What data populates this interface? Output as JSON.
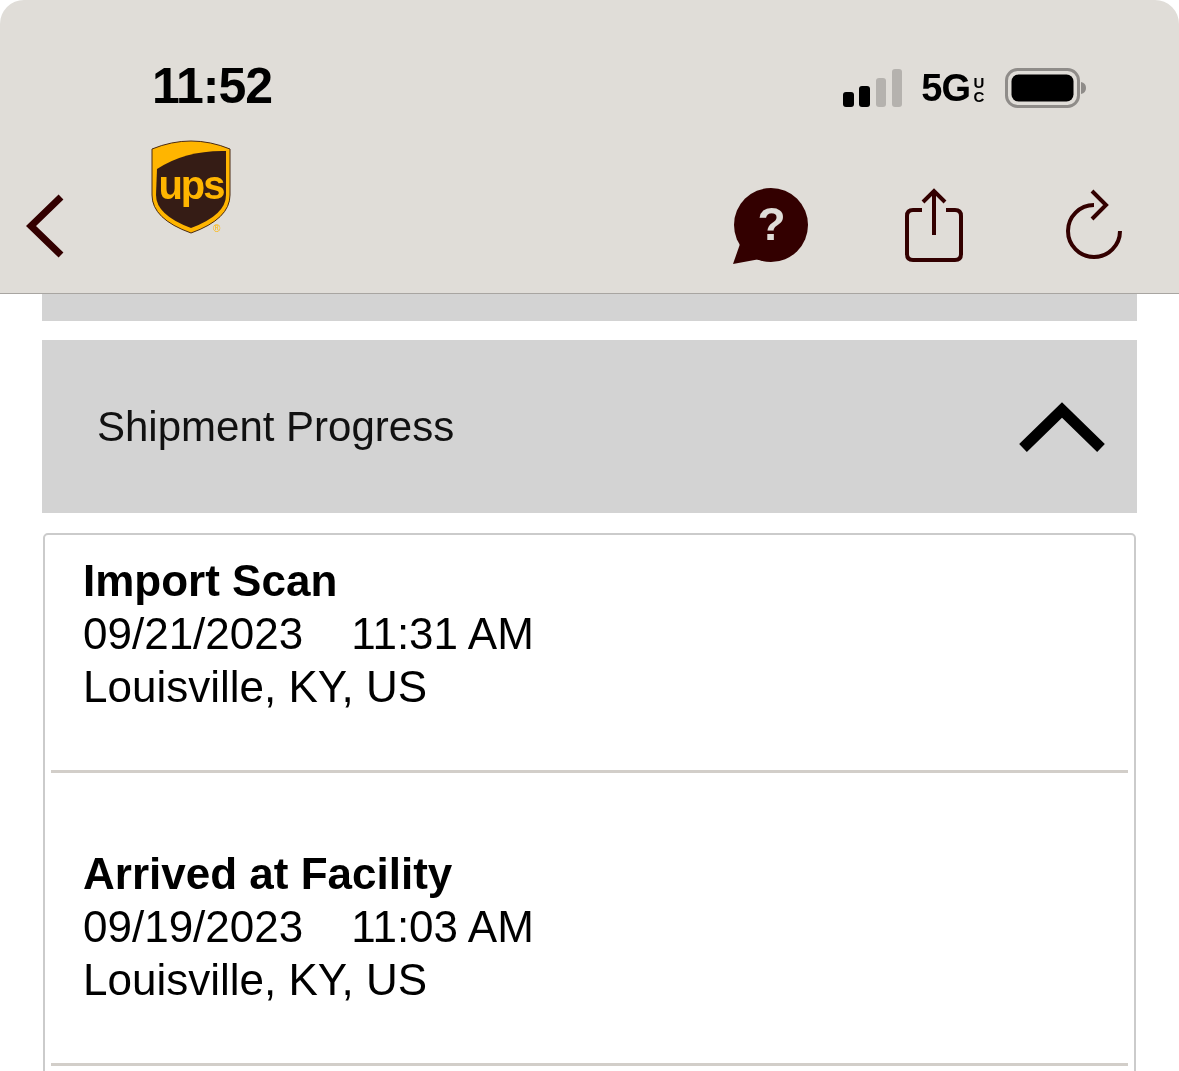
{
  "status_bar": {
    "time": "11:52",
    "network": "5G",
    "network_suffix": "UC"
  },
  "nav_bar": {
    "logo": {
      "text": "ups",
      "mark": "®"
    },
    "help_button": {
      "label": "?"
    }
  },
  "panel": {
    "title": "Shipment Progress",
    "expanded": true,
    "events": [
      {
        "title": "Import Scan",
        "date": "09/21/2023",
        "time": "11:31 AM",
        "location": "Louisville, KY, US"
      },
      {
        "title": "Arrived at Facility",
        "date": "09/19/2023",
        "time": "11:03 AM",
        "location": "Louisville, KY, US"
      }
    ]
  }
}
